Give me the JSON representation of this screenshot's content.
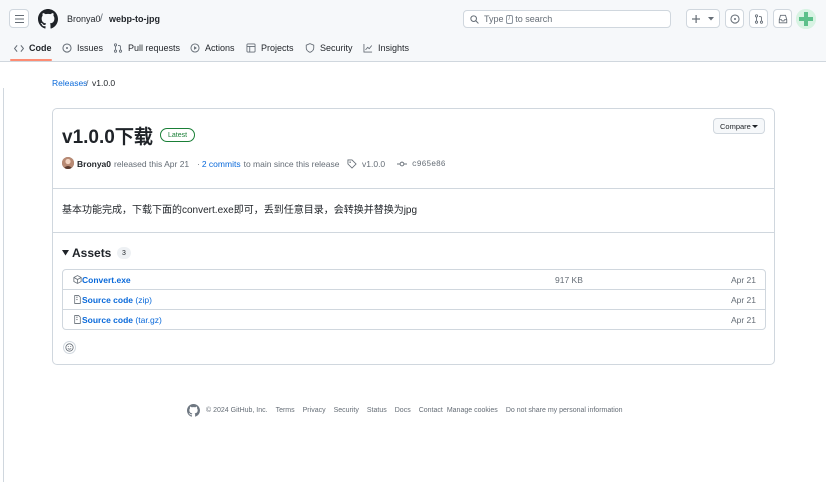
{
  "header": {
    "owner": "Bronya0",
    "separator": "/",
    "repo": "webp-to-jpg",
    "search": {
      "prefix": "Type",
      "key": "/",
      "suffix": "to search"
    }
  },
  "nav": {
    "tabs": [
      {
        "label": "Code",
        "icon": "code-icon",
        "active": true
      },
      {
        "label": "Issues",
        "icon": "issue-opened-icon"
      },
      {
        "label": "Pull requests",
        "icon": "git-pull-request-icon"
      },
      {
        "label": "Actions",
        "icon": "play-icon"
      },
      {
        "label": "Projects",
        "icon": "table-icon"
      },
      {
        "label": "Security",
        "icon": "shield-icon"
      },
      {
        "label": "Insights",
        "icon": "graph-icon"
      }
    ]
  },
  "breadcrumb": {
    "link": "Releases",
    "separator": "/",
    "current": "v1.0.0"
  },
  "release": {
    "title": "v1.0.0下载",
    "badge": "Latest",
    "compare_label": "Compare",
    "author": "Bronya0",
    "released_text": "released this Apr 21",
    "commits_prefix": "·",
    "commits_link": "2 commits",
    "commits_suffix": "to main since this release",
    "tag": "v1.0.0",
    "commit_sha": "c965e86",
    "description": "基本功能完成，下载下面的convert.exe即可，丢到任意目录，会转换并替换为jpg"
  },
  "assets": {
    "title": "Assets",
    "count": "3",
    "items": [
      {
        "name": "Convert.exe",
        "sub": "",
        "size": "917 KB",
        "date": "Apr 21",
        "icon": "package-icon"
      },
      {
        "name": "Source code",
        "sub": "(zip)",
        "size": "",
        "date": "Apr 21",
        "icon": "file-zip-icon"
      },
      {
        "name": "Source code",
        "sub": "(tar.gz)",
        "size": "",
        "date": "Apr 21",
        "icon": "file-zip-icon"
      }
    ]
  },
  "footer": {
    "copyright": "© 2024 GitHub, Inc.",
    "links": [
      "Terms",
      "Privacy",
      "Security",
      "Status",
      "Docs",
      "Contact",
      "Manage cookies",
      "Do not share my personal information"
    ]
  },
  "colors": {
    "link": "#0969da",
    "accent_underline": "#fd8c73",
    "latest_green": "#1a7f37",
    "border": "#d0d7de"
  }
}
